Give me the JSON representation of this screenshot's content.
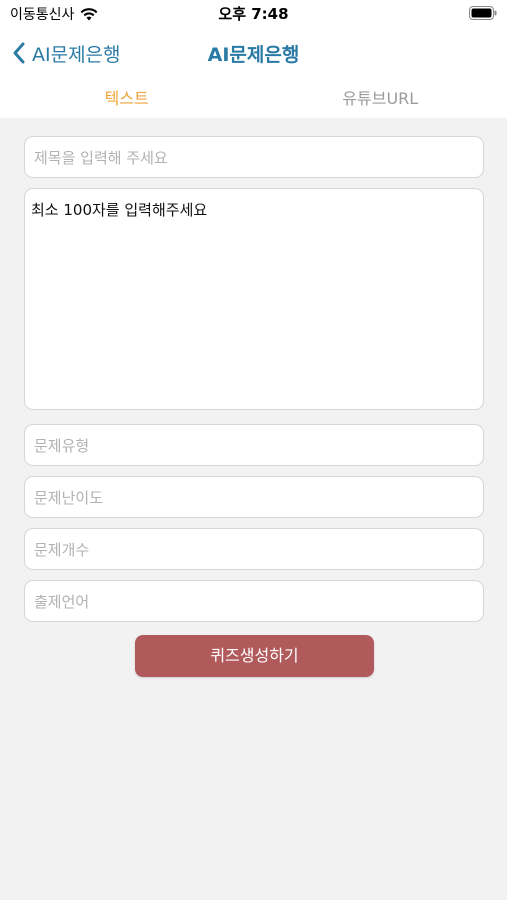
{
  "status_bar": {
    "carrier": "이동통신사",
    "time": "오후 7:48"
  },
  "nav": {
    "back_label": "AI문제은행",
    "title": "AI문제은행"
  },
  "tabs": [
    {
      "label": "텍스트",
      "active": true
    },
    {
      "label": "유튜브URL",
      "active": false
    }
  ],
  "form": {
    "title_placeholder": "제목을 입력해 주세요",
    "content_placeholder": "최소 100자를 입력해주세요",
    "type_placeholder": "문제유형",
    "difficulty_placeholder": "문제난이도",
    "count_placeholder": "문제개수",
    "language_placeholder": "출제언어",
    "submit_label": "퀴즈생성하기"
  },
  "colors": {
    "accent": "#2a7aa6",
    "active_tab": "#f0a53a",
    "submit_button": "#b05a5c"
  }
}
